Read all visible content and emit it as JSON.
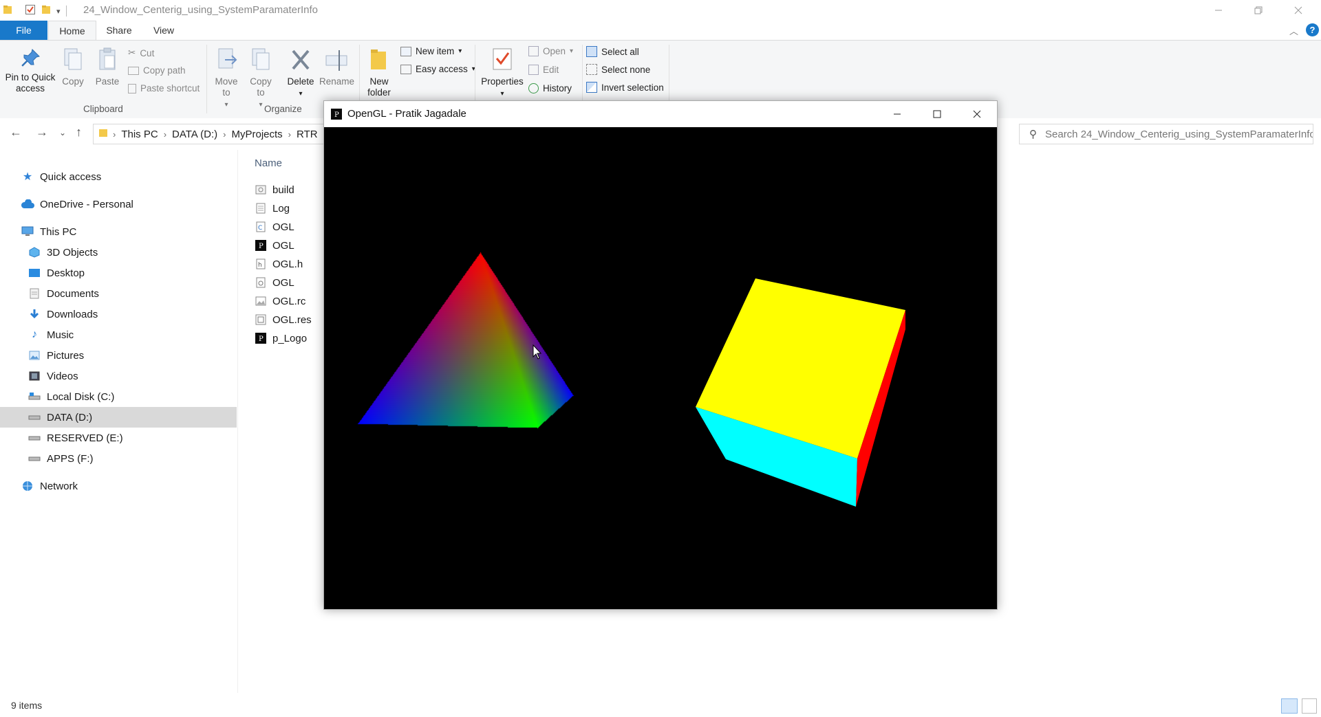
{
  "explorer": {
    "title": "24_Window_Centerig_using_SystemParamaterInfo",
    "tabs": [
      "File",
      "Home",
      "Share",
      "View"
    ],
    "ribbon": {
      "clipboard": {
        "label": "Clipboard",
        "pin": "Pin to Quick access",
        "copy": "Copy",
        "paste": "Paste",
        "cut": "Cut",
        "copy_path": "Copy path",
        "paste_shortcut": "Paste shortcut"
      },
      "organize": {
        "label": "Organize",
        "move_to": "Move to",
        "copy_to": "Copy to",
        "delete": "Delete",
        "rename": "Rename"
      },
      "new": {
        "new_folder": "New folder",
        "new_item": "New item",
        "easy_access": "Easy access"
      },
      "open": {
        "properties": "Properties",
        "open": "Open",
        "edit": "Edit",
        "history": "History"
      },
      "select": {
        "select_all": "Select all",
        "select_none": "Select none",
        "invert_selection": "Invert selection"
      }
    },
    "breadcrumb": [
      "This PC",
      "DATA (D:)",
      "MyProjects",
      "RTR"
    ],
    "search_placeholder": "Search 24_Window_Centerig_using_SystemParamaterInfo",
    "nav": {
      "quick_access": "Quick access",
      "onedrive": "OneDrive - Personal",
      "this_pc": "This PC",
      "items": [
        "3D Objects",
        "Desktop",
        "Documents",
        "Downloads",
        "Music",
        "Pictures",
        "Videos",
        "Local Disk (C:)",
        "DATA (D:)",
        "RESERVED (E:)",
        "APPS (F:)"
      ],
      "selected": "DATA (D:)",
      "network": "Network"
    },
    "column_name": "Name",
    "files": [
      "build",
      "Log",
      "OGL",
      "OGL",
      "OGL.h",
      "OGL",
      "OGL.rc",
      "OGL.res",
      "p_Logo"
    ],
    "status_count": "9 items"
  },
  "gl_window": {
    "title": "OpenGL - Pratik Jagadale",
    "colors": {
      "background": "#000000",
      "pyramid_top": "#ff0000",
      "pyramid_left": "#0000ff",
      "pyramid_right": "#00ff00",
      "cube_top": "#ffff00",
      "cube_front": "#00ffff",
      "cube_side": "#ff0000"
    }
  },
  "accent_color": "#1979ca"
}
